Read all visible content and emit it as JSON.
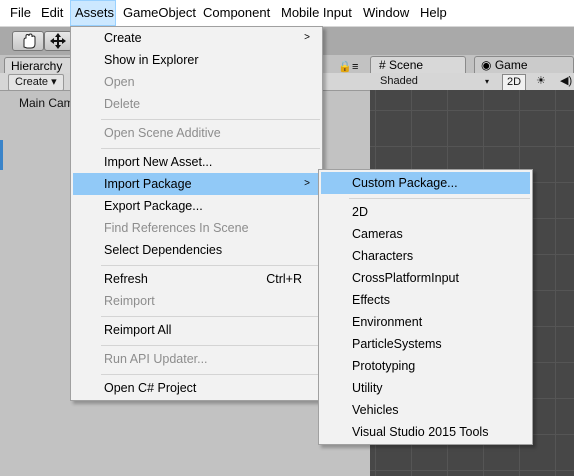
{
  "menubar": [
    "File",
    "Edit",
    "Assets",
    "GameObject",
    "Component",
    "Mobile Input",
    "Window",
    "Help"
  ],
  "toolbar": {
    "hand_icon": "hand-icon",
    "move_icon": "move-icon",
    "lock_glyph": "🔒",
    "layers_glyph": "≡"
  },
  "hierarchy": {
    "tab": "Hierarchy",
    "create": "Create ▾",
    "item": "Main Camera"
  },
  "scene": {
    "tab_scene": "Scene",
    "tab_game": "Game",
    "shaded": "Shaded",
    "mode_2d": "2D",
    "light_glyph": "☀",
    "extra_glyph": "◀)"
  },
  "assets_menu": [
    {
      "label": "Create",
      "submenu": true
    },
    {
      "label": "Show in Explorer"
    },
    {
      "label": "Open",
      "disabled": true
    },
    {
      "label": "Delete",
      "disabled": true
    },
    {
      "label": "Open Scene Additive",
      "disabled": true
    },
    {
      "label": "Import New Asset..."
    },
    {
      "label": "Import Package",
      "submenu": true,
      "highlighted": true
    },
    {
      "label": "Export Package..."
    },
    {
      "label": "Find References In Scene",
      "disabled": true
    },
    {
      "label": "Select Dependencies"
    },
    {
      "label": "Refresh",
      "shortcut": "Ctrl+R"
    },
    {
      "label": "Reimport",
      "disabled": true
    },
    {
      "label": "Reimport All"
    },
    {
      "label": "Run API Updater...",
      "disabled": true
    },
    {
      "label": "Open C# Project"
    }
  ],
  "import_package_menu": [
    {
      "label": "Custom Package...",
      "highlighted": true
    },
    {
      "label": "2D"
    },
    {
      "label": "Cameras"
    },
    {
      "label": "Characters"
    },
    {
      "label": "CrossPlatformInput"
    },
    {
      "label": "Effects"
    },
    {
      "label": "Environment"
    },
    {
      "label": "ParticleSystems"
    },
    {
      "label": "Prototyping"
    },
    {
      "label": "Utility"
    },
    {
      "label": "Vehicles"
    },
    {
      "label": "Visual Studio 2015 Tools"
    }
  ]
}
